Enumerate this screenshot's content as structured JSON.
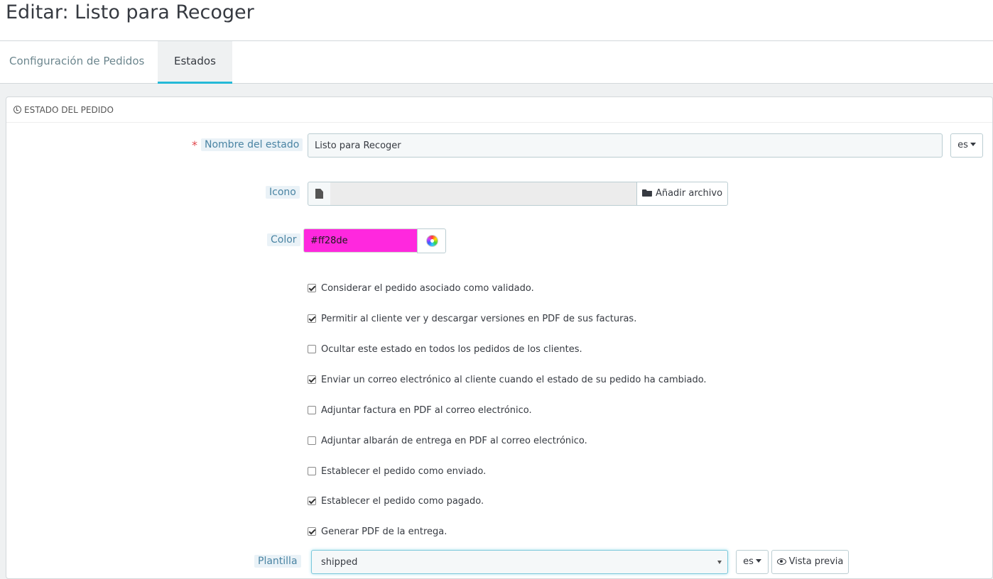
{
  "page": {
    "title": "Editar: Listo para Recoger"
  },
  "tabs": [
    {
      "label": "Configuración de Pedidos",
      "active": false
    },
    {
      "label": "Estados",
      "active": true
    }
  ],
  "panel": {
    "heading": "ESTADO DEL PEDIDO",
    "required_mark": "*",
    "name_field": {
      "label": "Nombre del estado",
      "value": "Listo para Recoger",
      "lang": "es"
    },
    "icon_field": {
      "label": "Icono",
      "add_button": "Añadir archivo"
    },
    "color_field": {
      "label": "Color",
      "value": "#ff28de"
    },
    "checkboxes": [
      {
        "label": "Considerar el pedido asociado como validado.",
        "checked": true
      },
      {
        "label": "Permitir al cliente ver y descargar versiones en PDF de sus facturas.",
        "checked": true
      },
      {
        "label": "Ocultar este estado en todos los pedidos de los clientes.",
        "checked": false
      },
      {
        "label": "Enviar un correo electrónico al cliente cuando el estado de su pedido ha cambiado.",
        "checked": true
      },
      {
        "label": "Adjuntar factura en PDF al correo electrónico.",
        "checked": false
      },
      {
        "label": "Adjuntar albarán de entrega en PDF al correo electrónico.",
        "checked": false
      },
      {
        "label": "Establecer el pedido como enviado.",
        "checked": false
      },
      {
        "label": "Establecer el pedido como pagado.",
        "checked": true
      },
      {
        "label": "Generar PDF de la entrega.",
        "checked": true
      }
    ],
    "template_field": {
      "label": "Plantilla",
      "value": "shipped",
      "lang": "es",
      "preview_button": "Vista previa"
    }
  },
  "colors": {
    "accent": "#25b9d7",
    "swatch": "#ff28de",
    "label_text": "#4a84a3"
  },
  "icons": [
    "clock-icon",
    "file-icon",
    "folder-open-icon",
    "color-wheel-icon",
    "eye-icon",
    "caret-down-icon"
  ]
}
